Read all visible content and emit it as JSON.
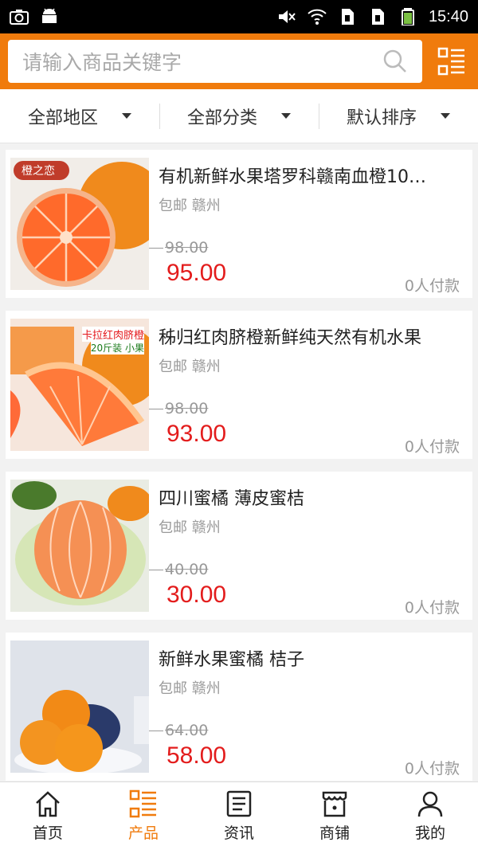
{
  "status_bar": {
    "time": "15:40",
    "icons": [
      "camera-icon",
      "android-icon",
      "mute-icon",
      "wifi-icon",
      "sim1-icon",
      "sim2-icon",
      "battery-icon"
    ]
  },
  "search": {
    "placeholder": "请输入商品关键字",
    "icon": "search-icon",
    "menu_icon": "list-grid-icon"
  },
  "filters": [
    {
      "label": "全部地区"
    },
    {
      "label": "全部分类"
    },
    {
      "label": "默认排序"
    }
  ],
  "products": [
    {
      "title": "有机新鲜水果塔罗科赣南血橙10…",
      "tags": "包邮 赣州",
      "old_price": "98.00",
      "price": "95.00",
      "paid": "0人付款",
      "image_text": "橙之恋"
    },
    {
      "title": "秭归红肉脐橙新鲜纯天然有机水果",
      "tags": "包邮 赣州",
      "old_price": "98.00",
      "price": "93.00",
      "paid": "0人付款",
      "image_text_1": "卡拉红肉脐橙",
      "image_text_2": "20斤装 小果"
    },
    {
      "title": "四川蜜橘 薄皮蜜桔",
      "tags": "包邮 赣州",
      "old_price": "40.00",
      "price": "30.00",
      "paid": "0人付款"
    },
    {
      "title": "新鲜水果蜜橘 桔子",
      "tags": "包邮 赣州",
      "old_price": "64.00",
      "price": "58.00",
      "paid": "0人付款"
    }
  ],
  "nav": [
    {
      "label": "首页",
      "icon": "home-icon",
      "active": false
    },
    {
      "label": "产品",
      "icon": "product-list-icon",
      "active": true
    },
    {
      "label": "资讯",
      "icon": "news-icon",
      "active": false
    },
    {
      "label": "商铺",
      "icon": "store-icon",
      "active": false
    },
    {
      "label": "我的",
      "icon": "user-icon",
      "active": false
    }
  ],
  "colors": {
    "accent": "#f07b0c",
    "price": "#e31c1c"
  }
}
